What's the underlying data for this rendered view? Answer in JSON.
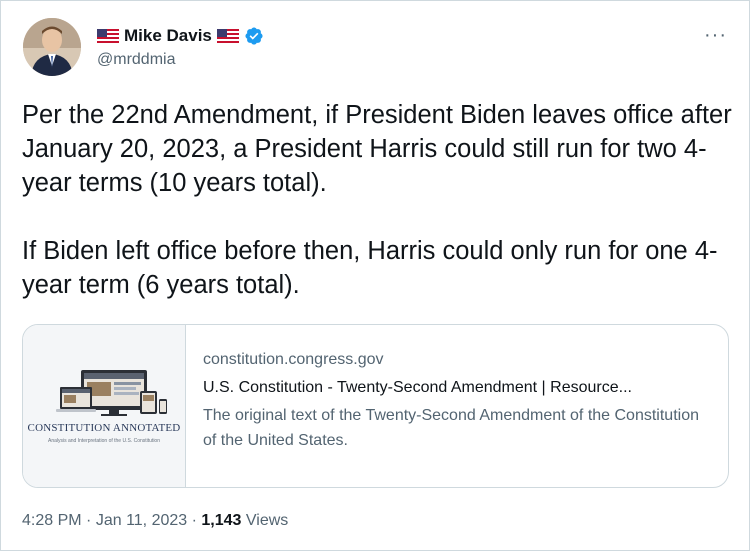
{
  "author": {
    "name": "Mike Davis",
    "handle": "@mrddmia",
    "verified": true,
    "flag_icon": "us-flag-icon"
  },
  "more_label": "···",
  "tweet": {
    "paragraphs": [
      "Per the 22nd Amendment, if President Biden leaves office after January 20, 2023, a President Harris could still run for two 4-year terms (10 years total).",
      "If Biden left office before then, Harris could only run for one 4-year term (6 years total)."
    ]
  },
  "card": {
    "domain": "constitution.congress.gov",
    "title": "U.S. Constitution - Twenty-Second Amendment | Resource...",
    "description": "The original text of the Twenty-Second Amendment of the Constitution of the United States.",
    "thumb_brand": "CONSTITUTION ANNOTATED",
    "thumb_sub": "Analysis and Interpretation of the U.S. Constitution"
  },
  "meta": {
    "time": "4:28 PM",
    "date": "Jan 11, 2023",
    "separator": "·",
    "views_count": "1,143",
    "views_label": "Views"
  },
  "colors": {
    "text": "#0f1419",
    "secondary": "#536471",
    "border": "#cfd9de",
    "verified": "#1d9bf0"
  }
}
